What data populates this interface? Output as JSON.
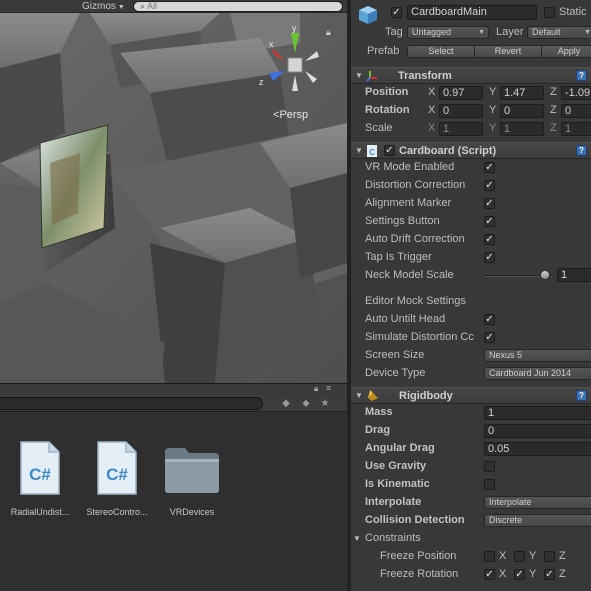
{
  "scene": {
    "gizmos_label": "Gizmos",
    "search_text": "All",
    "persp_label": "Persp",
    "axis_labels": {
      "y": "y",
      "x": "x",
      "z": "z"
    }
  },
  "project": {
    "assets": [
      {
        "name": "RadialUndist...",
        "glyph": "C#",
        "kind": "script"
      },
      {
        "name": "StereoContro...",
        "glyph": "C#",
        "kind": "script"
      },
      {
        "name": "VRDevices",
        "kind": "folder"
      }
    ]
  },
  "inspector": {
    "object_name": "CardboardMain",
    "active": true,
    "static_label": "Static",
    "tag_label": "Tag",
    "tag_value": "Untagged",
    "layer_label": "Layer",
    "layer_value": "Default",
    "prefab_label": "Prefab",
    "prefab_buttons": [
      "Select",
      "Revert",
      "Apply"
    ],
    "transform": {
      "title": "Transform",
      "rows": [
        {
          "label": "Position",
          "x": "0.97",
          "y": "1.47",
          "z": "-1.09"
        },
        {
          "label": "Rotation",
          "x": "0",
          "y": "0",
          "z": "0"
        },
        {
          "label": "Scale",
          "x": "1",
          "y": "1",
          "z": "1"
        }
      ]
    },
    "cardboard": {
      "title": "Cardboard (Script)",
      "enabled": true,
      "toggles": [
        {
          "label": "VR Mode Enabled",
          "checked": true
        },
        {
          "label": "Distortion Correction",
          "checked": true
        },
        {
          "label": "Alignment Marker",
          "checked": true
        },
        {
          "label": "Settings Button",
          "checked": true
        },
        {
          "label": "Auto Drift Correction",
          "checked": true
        },
        {
          "label": "Tap Is Trigger",
          "checked": true
        }
      ],
      "neck_label": "Neck Model Scale",
      "neck_value": "1",
      "neck_level": 1,
      "mock_header": "Editor Mock Settings",
      "mock_toggles": [
        {
          "label": "Auto Untilt Head",
          "checked": true
        },
        {
          "label": "Simulate Distortion Cc",
          "checked": true
        }
      ],
      "screen_size_label": "Screen Size",
      "screen_size_value": "Nexus 5",
      "device_type_label": "Device Type",
      "device_type_value": "Cardboard Jun 2014"
    },
    "rigidbody": {
      "title": "Rigidbody",
      "mass_label": "Mass",
      "mass_value": "1",
      "drag_label": "Drag",
      "drag_value": "0",
      "angular_drag_label": "Angular Drag",
      "angular_drag_value": "0.05",
      "use_gravity_label": "Use Gravity",
      "use_gravity": false,
      "is_kinematic_label": "Is Kinematic",
      "is_kinematic": false,
      "interpolate_label": "Interpolate",
      "interpolate_value": "Interpolate",
      "collision_label": "Collision Detection",
      "collision_value": "Discrete",
      "constraints_label": "Constraints",
      "freeze_position_label": "Freeze Position",
      "freeze_position": {
        "x": false,
        "y": false,
        "z": false
      },
      "freeze_rotation_label": "Freeze Rotation",
      "freeze_rotation": {
        "x": true,
        "y": true,
        "z": true
      }
    }
  },
  "colors": {
    "accent": "#3d6fb5",
    "axis_x": "#d9302c",
    "axis_y": "#6cc433",
    "axis_z": "#3c6fe0"
  }
}
